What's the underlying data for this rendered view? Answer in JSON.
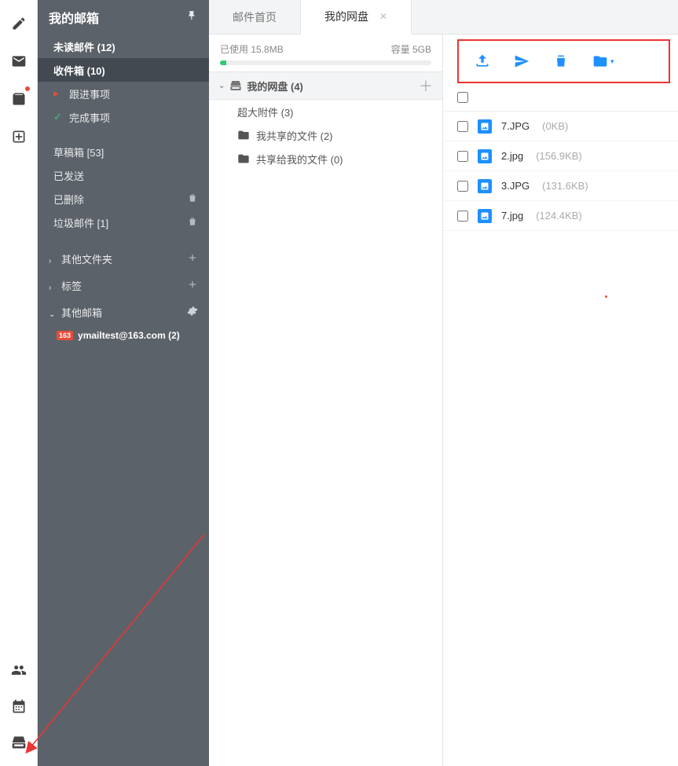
{
  "sidebar": {
    "title": "我的邮箱",
    "unread": "未读邮件 (12)",
    "inbox": "收件箱 (10)",
    "followup": "跟进事项",
    "done": "完成事项",
    "drafts": "草稿箱 [53]",
    "sent": "已发送",
    "deleted": "已删除",
    "junk": "垃圾邮件 [1]",
    "other_folders": "其他文件夹",
    "tags": "标签",
    "other_mail": "其他邮箱",
    "account_badge": "163",
    "account": "ymailtest@163.com (2)"
  },
  "tabs": {
    "home": "邮件首页",
    "disk": "我的网盘"
  },
  "storage": {
    "used_label": "已使用",
    "used_value": "15.8MB",
    "cap_label": "容量",
    "cap_value": "5GB"
  },
  "disk_nav": {
    "root": "我的网盘 (4)",
    "big_attach": "超大附件 (3)",
    "my_shared": "我共享的文件 (2)",
    "shared_to_me": "共享给我的文件 (0)"
  },
  "files": [
    {
      "name": "7.JPG",
      "size": "(0KB)"
    },
    {
      "name": "2.jpg",
      "size": "(156.9KB)"
    },
    {
      "name": "3.JPG",
      "size": "(131.6KB)"
    },
    {
      "name": "7.jpg",
      "size": "(124.4KB)"
    }
  ]
}
